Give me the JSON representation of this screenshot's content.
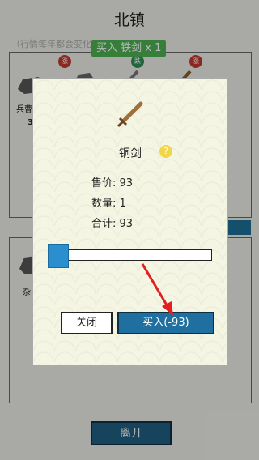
{
  "page": {
    "title": "北镇",
    "subtitle": "（行情每年都会变化"
  },
  "toast": {
    "text": "买入 铁剑 x 1"
  },
  "background": {
    "left_label_1": "兵曹",
    "left_value_1": "3",
    "left_label_2": "杂",
    "badges": [
      "涨",
      "跌",
      "涨"
    ]
  },
  "dialog": {
    "item_name": "铜剑",
    "help_icon": "help-icon",
    "price_label": "售价:",
    "price": "93",
    "qty_label": "数量:",
    "qty": "1",
    "total_label": "合计:",
    "total": "93",
    "slider_fraction": 0.0,
    "close_label": "关闭",
    "buy_label": "买入(-93)"
  },
  "footer": {
    "leave_label": "离开"
  },
  "colors": {
    "buy_button": "#1f6fa0",
    "arrow": "#e02020",
    "toast": "#4caf50"
  }
}
